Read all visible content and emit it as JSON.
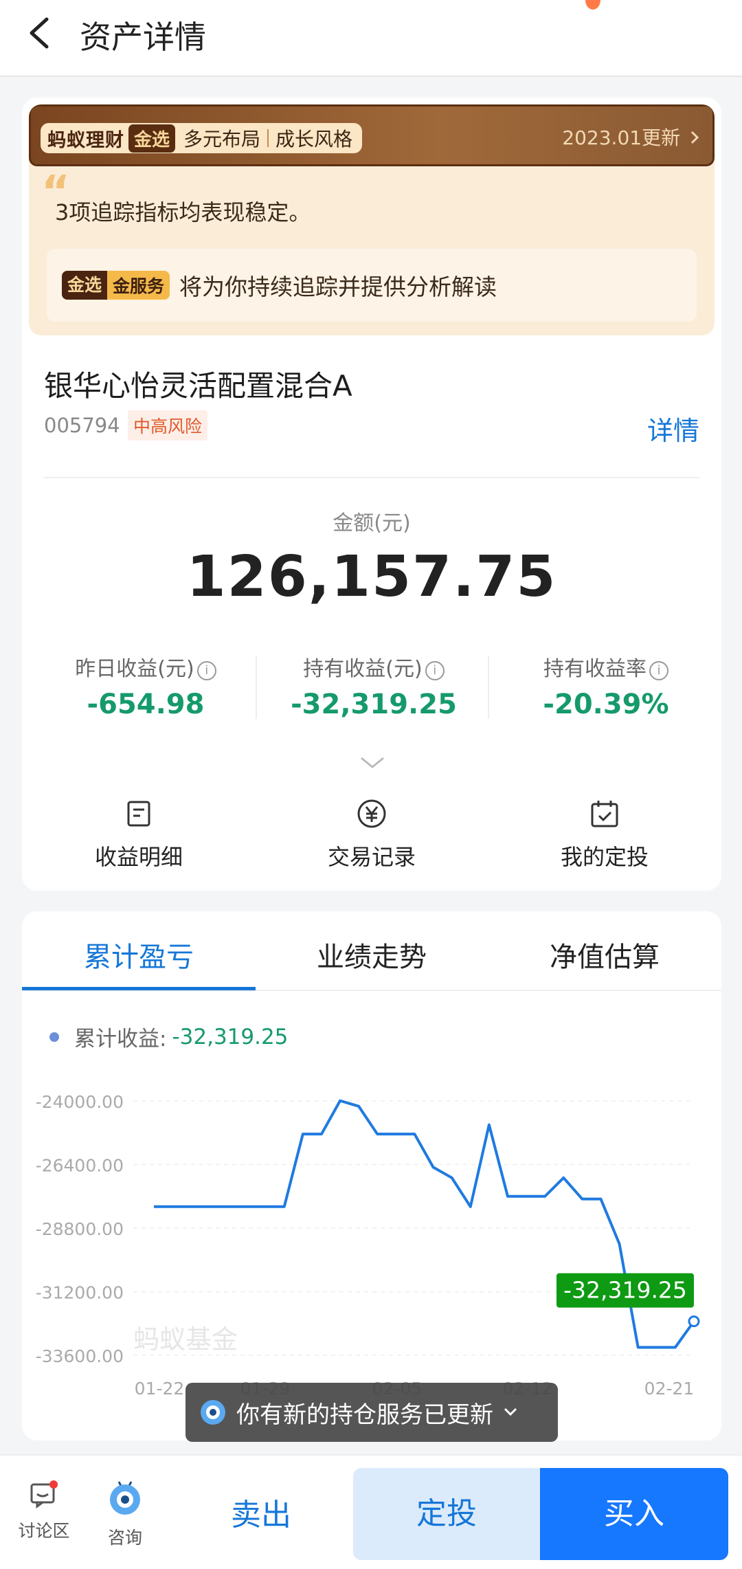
{
  "header": {
    "title": "资产详情"
  },
  "banner": {
    "brand": "蚂蚁理财",
    "badge": "金选",
    "tag1": "多元布局",
    "tag2": "成长风格",
    "update": "2023.01更新",
    "summary": "3项追踪指标均表现稳定。",
    "service_badge_1": "金选",
    "service_badge_2": "金服务",
    "service_text": "将为你持续追踪并提供分析解读"
  },
  "fund": {
    "name": "银华心怡灵活配置混合A",
    "code": "005794",
    "risk": "中高风险",
    "detail": "详情"
  },
  "amount": {
    "label": "金额(元)",
    "value": "126,157.75"
  },
  "stats": [
    {
      "label": "昨日收益(元)",
      "value": "-654.98"
    },
    {
      "label": "持有收益(元)",
      "value": "-32,319.25"
    },
    {
      "label": "持有收益率",
      "value": "-20.39%"
    }
  ],
  "actions": [
    {
      "label": "收益明细",
      "icon": "document-icon"
    },
    {
      "label": "交易记录",
      "icon": "yuan-circle-icon"
    },
    {
      "label": "我的定投",
      "icon": "calendar-check-icon"
    }
  ],
  "tabs": [
    "累计盈亏",
    "业绩走势",
    "净值估算"
  ],
  "legend": {
    "label": "累计收益:",
    "value": "-32,319.25"
  },
  "chart_data": {
    "type": "line",
    "watermark": "蚂蚁基金",
    "y_ticks": [
      "-24000.00",
      "-26400.00",
      "-28800.00",
      "-31200.00",
      "-33600.00"
    ],
    "ylim": [
      -33600,
      -24000
    ],
    "x_ticks": [
      "01-22",
      "01-29",
      "02-05",
      "02-12",
      "02-21"
    ],
    "series": [
      {
        "color": "#1f7ae0",
        "values": [
          -27990,
          -27990,
          -27990,
          -27990,
          -27990,
          -27990,
          -27990,
          -27990,
          -25250,
          -25250,
          -23990,
          -24200,
          -25250,
          -25250,
          -25250,
          -26500,
          -26900,
          -27990,
          -24900,
          -27600,
          -27600,
          -27600,
          -26900,
          -27700,
          -27700,
          -29400,
          -33300,
          -33300,
          -33300,
          -32319
        ]
      }
    ],
    "last_label": "-32,319.25",
    "colors": {
      "line": "#1f7ae0",
      "label_bg": "#0e9a12",
      "negative": "#159a6b"
    }
  },
  "toast": {
    "text": "你有新的持仓服务已更新"
  },
  "bottom": {
    "discuss": "讨论区",
    "consult": "咨询",
    "sell": "卖出",
    "dingtou": "定投",
    "buy": "买入"
  }
}
